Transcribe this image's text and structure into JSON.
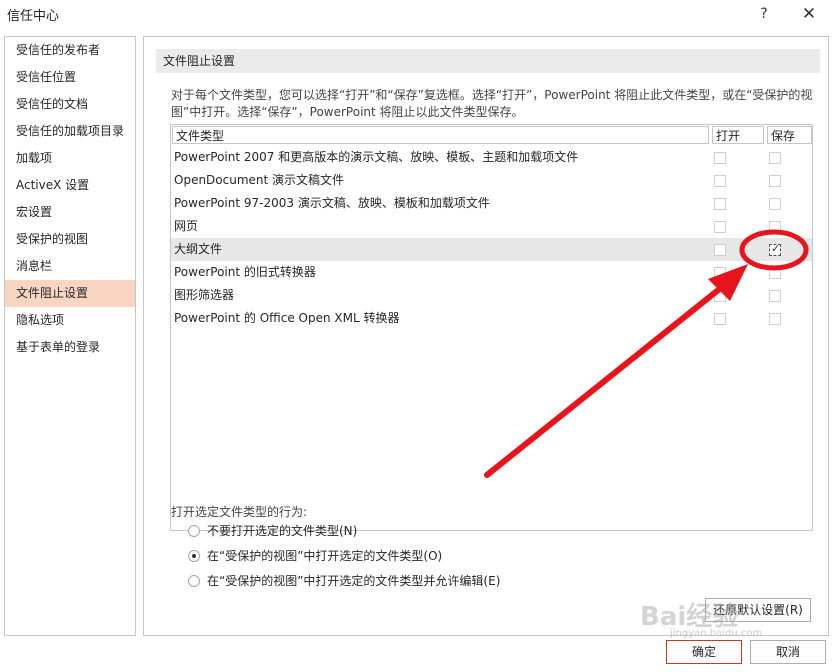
{
  "window": {
    "title": "信任中心",
    "help_label": "?",
    "close_label": "✕"
  },
  "nav": {
    "items": [
      {
        "label": "受信任的发布者"
      },
      {
        "label": "受信任位置"
      },
      {
        "label": "受信任的文档"
      },
      {
        "label": "受信任的加载项目录"
      },
      {
        "label": "加载项"
      },
      {
        "label": "ActiveX 设置"
      },
      {
        "label": "宏设置"
      },
      {
        "label": "受保护的视图"
      },
      {
        "label": "消息栏"
      },
      {
        "label": "文件阻止设置"
      },
      {
        "label": "隐私选项"
      },
      {
        "label": "基于表单的登录"
      }
    ],
    "selected": "文件阻止设置"
  },
  "main": {
    "section_title": "文件阻止设置",
    "description": "对于每个文件类型，您可以选择“打开”和“保存”复选框。选择“打开”，PowerPoint 将阻止此文件类型，或在“受保护的视图”中打开。选择“保存”，PowerPoint 将阻止以此文件类型保存。",
    "table": {
      "headers": {
        "type": "文件类型",
        "open": "打开",
        "save": "保存"
      },
      "rows": [
        {
          "label": "PowerPoint 2007 和更高版本的演示文稿、放映、模板、主题和加载项文件",
          "open": false,
          "save": false
        },
        {
          "label": "OpenDocument 演示文稿文件",
          "open": false,
          "save": false
        },
        {
          "label": "PowerPoint 97-2003 演示文稿、放映、模板和加载项文件",
          "open": false,
          "save": false
        },
        {
          "label": "网页",
          "open": false,
          "save": false
        },
        {
          "label": "大纲文件",
          "open": false,
          "save": true
        },
        {
          "label": "PowerPoint 的旧式转换器",
          "open": false,
          "save": false
        },
        {
          "label": "图形筛选器",
          "open": false,
          "save": false
        },
        {
          "label": "PowerPoint 的 Office Open XML 转换器",
          "open": false,
          "save": false
        }
      ]
    },
    "behavior": {
      "label": "打开选定文件类型的行为:",
      "options": [
        {
          "label": "不要打开选定的文件类型(N)",
          "selected": false
        },
        {
          "label": "在“受保护的视图”中打开选定的文件类型(O)",
          "selected": true
        },
        {
          "label": "在“受保护的视图”中打开选定的文件类型并允许编辑(E)",
          "selected": false
        }
      ]
    },
    "restore_button": "还原默认设置(R)"
  },
  "footer": {
    "ok_label": "确定",
    "cancel_label": "取消"
  },
  "annotation": {
    "color": "#e8141c"
  },
  "watermark": {
    "text": "Bai经验",
    "sub": "jingyan.baidu.com"
  }
}
